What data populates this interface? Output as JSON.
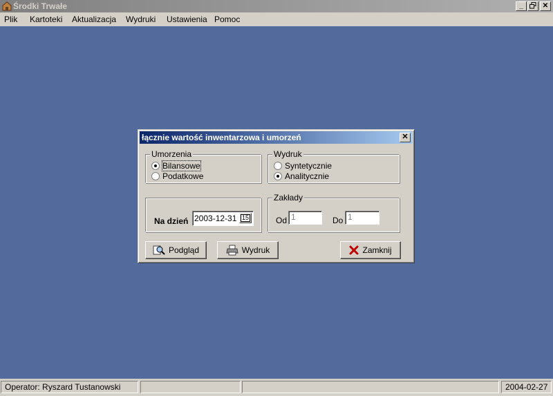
{
  "window": {
    "title": "Środki Trwałe"
  },
  "menu": [
    {
      "label": "Plik"
    },
    {
      "label": "Kartoteki"
    },
    {
      "label": "Aktualizacja"
    },
    {
      "label": "Wydruki"
    },
    {
      "label": "Ustawienia"
    },
    {
      "label": "Pomoc"
    }
  ],
  "dialog": {
    "title": "łącznie wartość inwentarzowa i umorzeń",
    "umorzenia": {
      "label": "Umorzenia",
      "options": [
        {
          "label": "Bilansowe",
          "selected": true
        },
        {
          "label": "Podatkowe",
          "selected": false
        }
      ]
    },
    "wydruk": {
      "label": "Wydruk",
      "options": [
        {
          "label": "Syntetycznie",
          "selected": false
        },
        {
          "label": "Analitycznie",
          "selected": true
        }
      ]
    },
    "na_dzien": {
      "label": "Na dzień",
      "value": "2003-12-31",
      "calendar_button": "15"
    },
    "zaklady": {
      "label": "Zakłady",
      "od_label": "Od",
      "od_value": "1",
      "do_label": "Do",
      "do_value": "1"
    },
    "buttons": {
      "preview": "Podgląd",
      "print": "Wydruk",
      "close": "Zamknij"
    }
  },
  "status": {
    "operator": "Operator: Ryszard Tustanowski",
    "date": "2004-02-27"
  }
}
